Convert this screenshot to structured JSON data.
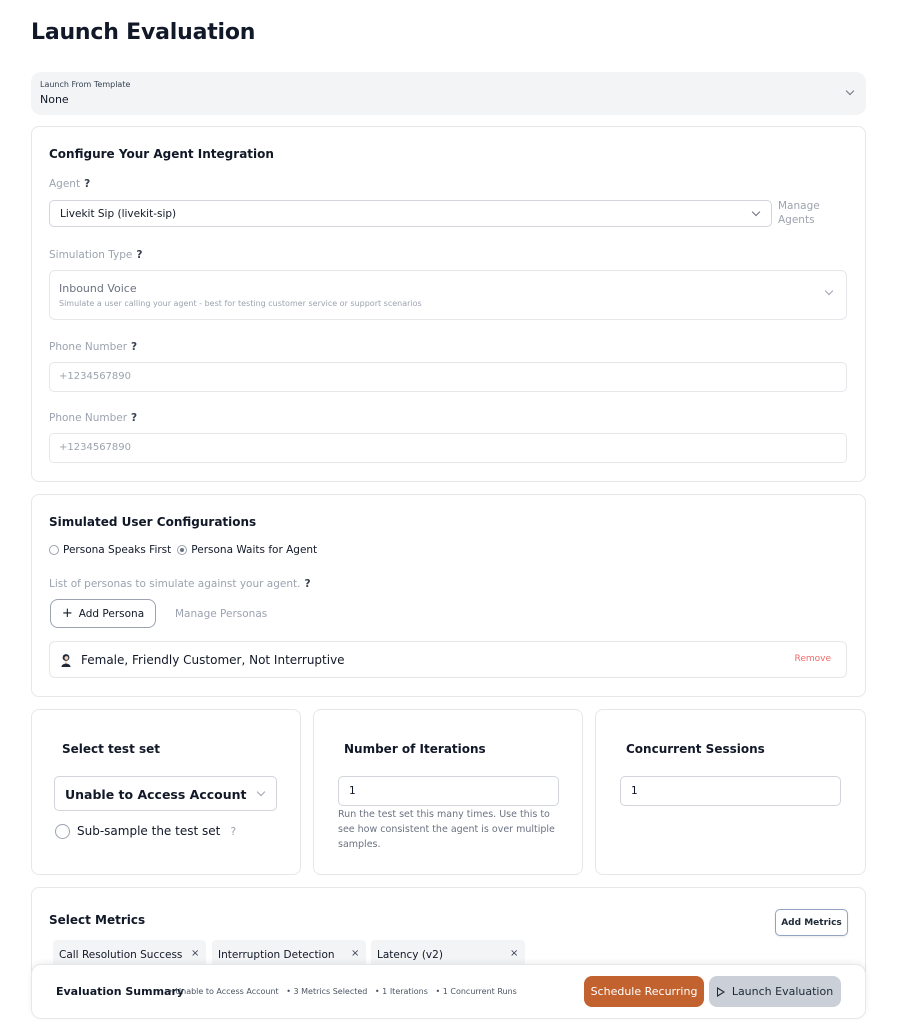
{
  "page": {
    "title": "Launch Evaluation"
  },
  "template": {
    "label": "Launch From Template",
    "value": "None"
  },
  "integration": {
    "title": "Configure Your Agent Integration",
    "agent_label": "Agent",
    "help_mark": "?",
    "agent_value": "Livekit Sip (livekit-sip)",
    "manage_agents": "Manage Agents",
    "simulation_type_label": "Simulation Type",
    "simulation_type_title": "Inbound Voice",
    "simulation_type_desc": "Simulate a user calling your agent - best for testing customer service or support scenarios",
    "phone_label_1": "Phone Number",
    "phone_placeholder_1": "+1234567890",
    "phone_label_2": "Phone Number",
    "phone_placeholder_2": "+1234567890"
  },
  "simulated_users": {
    "title": "Simulated User Configurations",
    "radio_speaks_first": "Persona Speaks First",
    "radio_waits": "Persona Waits for Agent",
    "selected": "Persona Waits for Agent",
    "list_label": "List of personas to simulate against your agent.",
    "help_mark": "?",
    "add_persona": "Add Persona",
    "manage_personas": "Manage Personas",
    "personas": [
      {
        "name": "Female, Friendly Customer, Not Interruptive",
        "remove": "Remove"
      }
    ]
  },
  "test_set": {
    "title": "Select test set",
    "value": "Unable to Access Account",
    "subsample_label": "Sub-sample the test set",
    "help_mark": "?"
  },
  "iterations": {
    "title": "Number of Iterations",
    "value": "1",
    "help": "Run the test set this many times. Use this to see how consistent the agent is over multiple samples."
  },
  "concurrency": {
    "title": "Concurrent Sessions",
    "value": "1"
  },
  "metrics": {
    "title": "Select Metrics",
    "add_button": "Add Metrics",
    "selected": [
      "Call Resolution Success",
      "Interruption Detection",
      "Latency (v2)"
    ],
    "remove_glyph": "×"
  },
  "summary": {
    "title": "Evaluation Summary",
    "items": [
      "• Unable to Access Account",
      "• 3 Metrics Selected",
      "• 1 Iterations",
      "• 1 Concurrent Runs"
    ],
    "schedule_button": "Schedule Recurring",
    "launch_button": "Launch Evaluation"
  },
  "colors": {
    "schedule_bg": "#c2622f",
    "launch_bg": "#cbd0d8",
    "remove_text": "#ef6b6b"
  }
}
